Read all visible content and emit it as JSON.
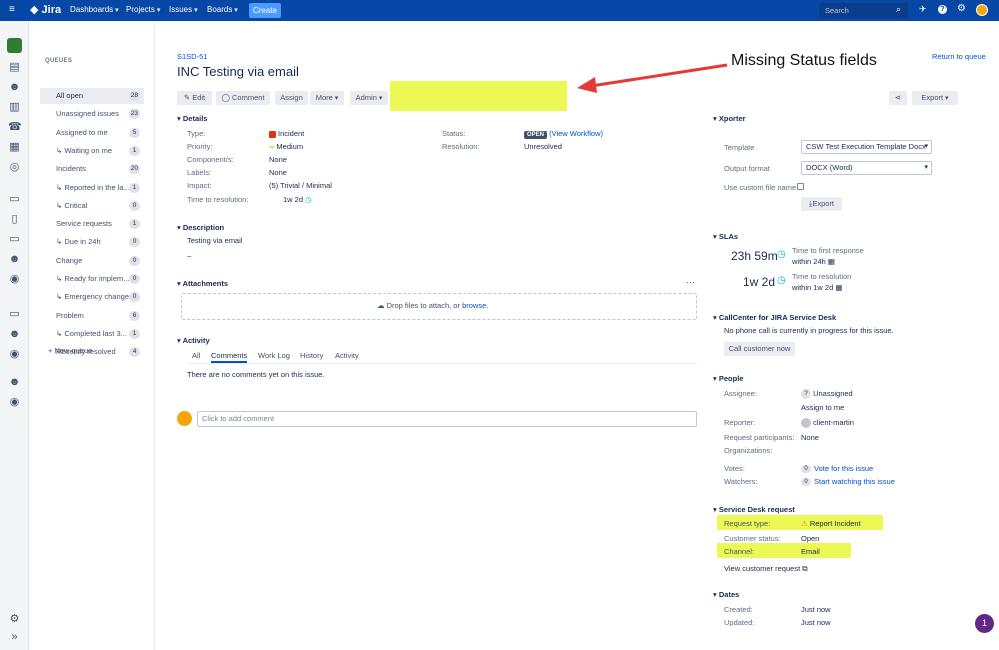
{
  "topnav": {
    "product": "Jira",
    "menus": [
      "Dashboards",
      "Projects",
      "Issues",
      "Boards"
    ],
    "create_label": "Create",
    "search_placeholder": "Search"
  },
  "queues": {
    "heading": "QUEUES",
    "items": [
      {
        "label": "All open",
        "count": "28",
        "active": true
      },
      {
        "label": "Unassigned issues",
        "count": "23"
      },
      {
        "label": "Assigned to me",
        "count": "5"
      },
      {
        "label": "↳ Waiting on me",
        "count": "1"
      },
      {
        "label": "Incidents",
        "count": "20"
      },
      {
        "label": "↳ Reported in the la...",
        "count": "1"
      },
      {
        "label": "↳ Critical",
        "count": "0"
      },
      {
        "label": "Service requests",
        "count": "1"
      },
      {
        "label": "↳ Due in 24h",
        "count": "0"
      },
      {
        "label": "Change",
        "count": "0"
      },
      {
        "label": "↳ Ready for implem...",
        "count": "0"
      },
      {
        "label": "↳ Emergency change",
        "count": "0"
      },
      {
        "label": "Problem",
        "count": "6"
      },
      {
        "label": "↳ Completed last 3...",
        "count": "1"
      },
      {
        "label": "Recently resolved",
        "count": "4"
      }
    ],
    "new_queue": "+ New queue"
  },
  "issue": {
    "key": "S1SD-51",
    "title": "INC Testing via email",
    "return_link": "Return to queue",
    "annotation": "Missing Status fields",
    "toolbar": {
      "edit": "Edit",
      "comment": "Comment",
      "assign": "Assign",
      "more": "More",
      "admin": "Admin",
      "export": "Export"
    }
  },
  "details": {
    "heading": "Details",
    "type_label": "Type:",
    "type_value": "Incident",
    "priority_label": "Priority:",
    "priority_value": "Medium",
    "components_label": "Component/s:",
    "components_value": "None",
    "labels_label": "Labels:",
    "labels_value": "None",
    "impact_label": "Impact:",
    "impact_value": "(5) Trivial / Minimal",
    "ttr_label": "Time to resolution:",
    "ttr_value": "1w 2d",
    "status_label": "Status:",
    "status_value": "OPEN",
    "status_link": "(View Workflow)",
    "resolution_label": "Resolution:",
    "resolution_value": "Unresolved"
  },
  "description": {
    "heading": "Description",
    "text": "Testing via email",
    "extra": "–"
  },
  "attachments": {
    "heading": "Attachments",
    "drop_text": "Drop files to attach, or",
    "browse": "browse."
  },
  "activity": {
    "heading": "Activity",
    "tabs": [
      "All",
      "Comments",
      "Work Log",
      "History",
      "Activity"
    ],
    "active_tab": "Comments",
    "empty": "There are no comments yet on this issue.",
    "comment_placeholder": "Click to add comment"
  },
  "xporter": {
    "heading": "Xporter",
    "template_label": "Template",
    "template_value": "CSW Test Execution Template Docx",
    "format_label": "Output format",
    "format_value": "DOCX (Word)",
    "custom_label": "Use custom file name",
    "export_btn": "Export"
  },
  "slas": {
    "heading": "SLAs",
    "items": [
      {
        "time": "23h 59m",
        "name": "Time to first response",
        "goal": "within 24h"
      },
      {
        "time": "1w 2d",
        "name": "Time to resolution",
        "goal": "within 1w 2d"
      }
    ]
  },
  "callcenter": {
    "heading": "CallCenter for JIRA Service Desk",
    "text": "No phone call is currently in progress for this issue.",
    "button": "Call customer now"
  },
  "people": {
    "heading": "People",
    "assignee_label": "Assignee:",
    "assignee_value": "Unassigned",
    "assign_me": "Assign to me",
    "reporter_label": "Reporter:",
    "reporter_value": "client-martin",
    "participants_label": "Request participants:",
    "participants_value": "None",
    "orgs_label": "Organizations:",
    "votes_label": "Votes:",
    "votes_count": "0",
    "votes_link": "Vote for this issue",
    "watchers_label": "Watchers:",
    "watchers_count": "0",
    "watchers_link": "Start watching this issue"
  },
  "sdrequest": {
    "heading": "Service Desk request",
    "type_label": "Request type:",
    "type_value": "Report Incident",
    "status_label": "Customer status:",
    "status_value": "Open",
    "channel_label": "Channel:",
    "channel_value": "Email",
    "view_link": "View customer request"
  },
  "dates": {
    "heading": "Dates",
    "created_label": "Created:",
    "created_value": "Just now",
    "updated_label": "Updated:",
    "updated_value": "Just now"
  },
  "help_badge": "1",
  "colors": {
    "nav": "#0747a6",
    "highlight": "#ecf853",
    "arrow": "#e53935",
    "link": "#0052cc"
  }
}
